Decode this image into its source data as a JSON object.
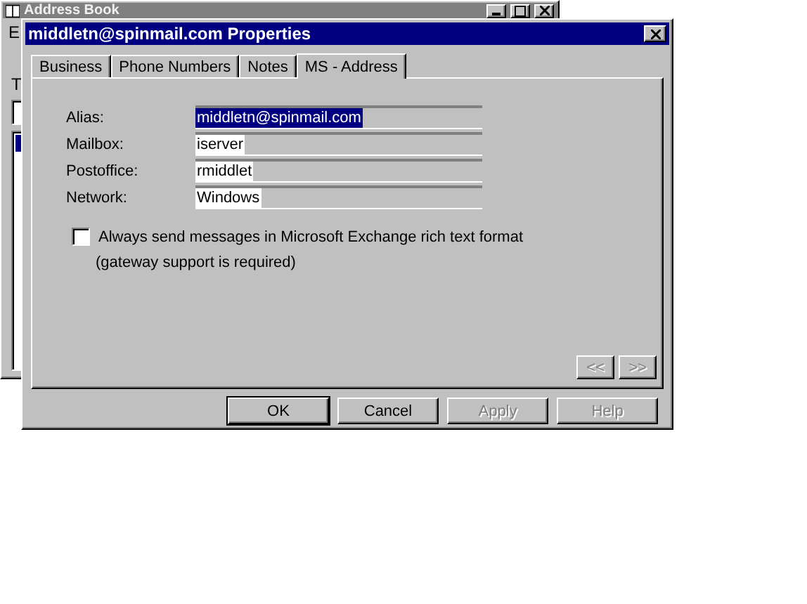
{
  "back_window": {
    "title": "Address Book",
    "menu": [
      "E"
    ],
    "label": "T",
    "list_selected": true
  },
  "dialog": {
    "title": "middletn@spinmail.com Properties",
    "tabs": [
      {
        "label": "Business",
        "selected": false
      },
      {
        "label": "Phone Numbers",
        "selected": false
      },
      {
        "label": "Notes",
        "selected": false
      },
      {
        "label": "MS - Address",
        "selected": true
      }
    ],
    "fields": [
      {
        "label": "Alias:",
        "value": "middletn@spinmail.com",
        "selected": true
      },
      {
        "label": "Mailbox:",
        "value": "iserver",
        "selected": false
      },
      {
        "label": "Postoffice:",
        "value": "rmiddlet",
        "selected": false
      },
      {
        "label": "Network:",
        "value": "Windows",
        "selected": false
      }
    ],
    "checkbox": {
      "label": "Always send messages in Microsoft Exchange rich text format",
      "checked": false
    },
    "note": "(gateway support is required)",
    "nav": [
      {
        "label": "<<",
        "disabled": true
      },
      {
        "label": ">>",
        "disabled": true
      }
    ],
    "buttons": [
      {
        "label": "OK",
        "disabled": false,
        "default": true
      },
      {
        "label": "Cancel",
        "disabled": false,
        "default": false
      },
      {
        "label": "Apply",
        "disabled": true,
        "default": false
      },
      {
        "label": "Help",
        "disabled": true,
        "default": false
      }
    ]
  }
}
